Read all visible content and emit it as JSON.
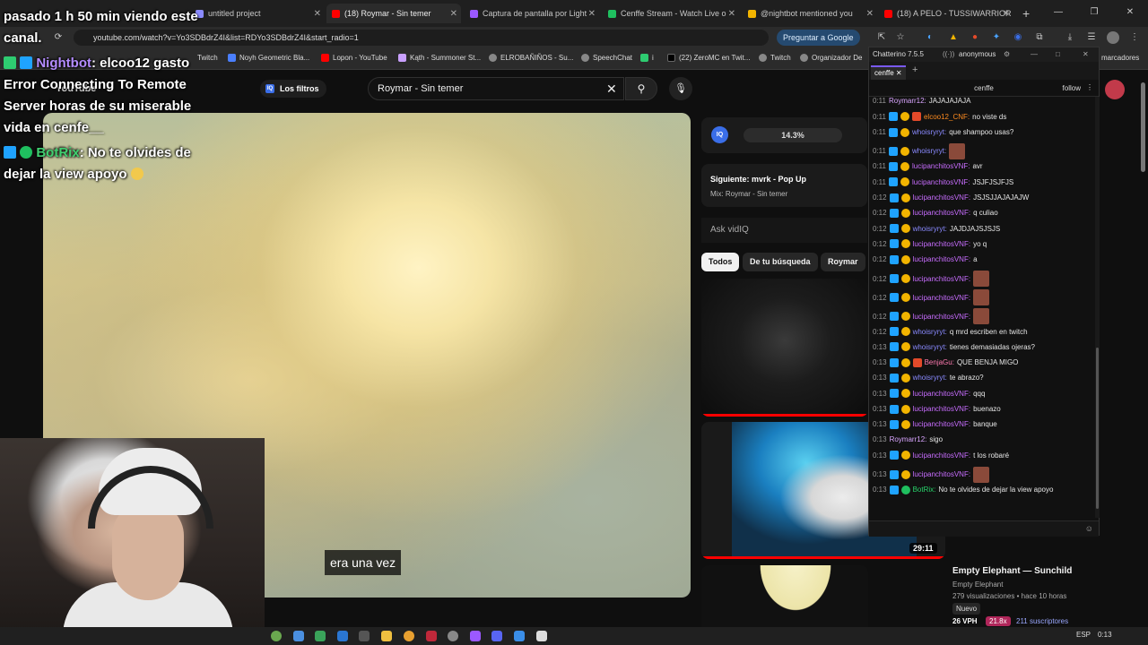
{
  "browser": {
    "tabs": [
      {
        "label": "untitled project",
        "color": "#8a8aff"
      },
      {
        "label": "(18) Roymar - Sin temer",
        "color": "#ff0000"
      },
      {
        "label": "Captura de pantalla por Light",
        "color": "#9b59ff"
      },
      {
        "label": "Cenffe Stream - Watch Live o",
        "color": "#1fbf5f"
      },
      {
        "label": "@nightbot mentioned you",
        "color": "#f2b400"
      },
      {
        "label": "(18) A PELO - TUSSIWARRIOR",
        "color": "#ff0000"
      }
    ],
    "url": "youtube.com/watch?v=Yo3SDBdrZ4I&list=RDYo3SDBdrZ4I&start_radio=1",
    "translate_button": "Preguntar a Google",
    "bookmarks": [
      "Twitch",
      "Noyh Geometric Bla...",
      "Lopon - YouTube",
      "Kąth - Summoner St...",
      "ELROBAÑIÑOS - Su...",
      "SpeechChat",
      "i",
      "(22) ZeroMC en Twit...",
      "Twitch",
      "Organizador De",
      "marcadores"
    ]
  },
  "overlay": {
    "line1": "pasado 1 h 50 min viendo este",
    "line2": "canal.",
    "nightbot_name": "Nightbot",
    "nightbot_msg": ": elcoo12 gasto",
    "error_line1": "Error Connecting To Remote",
    "error_line2": "Server horas de su miserable",
    "error_line3": "vida en cenfe__",
    "botrix_name": "BotRix",
    "botrix_msg_line1": ": No te olvides de",
    "botrix_msg_line2": "dejar la view apoyo"
  },
  "youtube": {
    "logo_text": "YouTube",
    "filters": "Los filtros",
    "search_value": "Roymar - Sin temer",
    "subtitle": "era una vez",
    "vidiq_label": "IQ",
    "vidiq_percent": "14.3%",
    "next_label": "Siguiente: mvrk - Pop Up",
    "next_sub": "Mix: Roymar - Sin temer",
    "ask_placeholder": "Ask vidIQ",
    "chips": [
      "Todos",
      "De tu búsqueda",
      "Roymar"
    ],
    "duration2": "29:11",
    "rec_title": "Empty Elephant — Sunchild",
    "rec_channel": "Empty Elephant",
    "rec_meta": "279 visualizaciones • hace 10 horas",
    "rec_badge": "Nuevo",
    "rec_vph": "26 VPH",
    "rec_score": "21.8x",
    "rec_subs": "211 suscriptores"
  },
  "chatterino": {
    "title": "Chatterino 7.5.5",
    "user": "anonymous",
    "tab": "cenffe",
    "channel": "cenffe",
    "follow": "follow",
    "messages": [
      {
        "ts": "0:11",
        "user": "Roymarr12:",
        "cls": "u-roy",
        "text": "JAJAJAJAJA",
        "icons": ""
      },
      {
        "ts": "0:11",
        "user": "elcoo12_CNF:",
        "cls": "u-elco",
        "text": "no viste ds",
        "icons": "bgr"
      },
      {
        "ts": "0:11",
        "user": "whoisryryt:",
        "cls": "u-whoi",
        "text": "que shampoo usas?",
        "icons": "bg"
      },
      {
        "ts": "0:11",
        "user": "whoisryryt:",
        "cls": "u-whoi",
        "text": "",
        "icons": "bg",
        "emote": true
      },
      {
        "ts": "0:11",
        "user": "lucipanchitosVNF:",
        "cls": "u-luci",
        "text": "avr",
        "icons": "bg"
      },
      {
        "ts": "0:11",
        "user": "lucipanchitosVNF:",
        "cls": "u-luci",
        "text": "JSJFJSJFJS",
        "icons": "bg"
      },
      {
        "ts": "0:12",
        "user": "lucipanchitosVNF:",
        "cls": "u-luci",
        "text": "JSJSJJAJAJAJW",
        "icons": "bg"
      },
      {
        "ts": "0:12",
        "user": "lucipanchitosVNF:",
        "cls": "u-luci",
        "text": "q culiao",
        "icons": "bg"
      },
      {
        "ts": "0:12",
        "user": "whoisryryt:",
        "cls": "u-whoi",
        "text": "JAJDJAJSJSJS",
        "icons": "bg"
      },
      {
        "ts": "0:12",
        "user": "lucipanchitosVNF:",
        "cls": "u-luci",
        "text": "yo q",
        "icons": "bg"
      },
      {
        "ts": "0:12",
        "user": "lucipanchitosVNF:",
        "cls": "u-luci",
        "text": "a",
        "icons": "bg"
      },
      {
        "ts": "0:12",
        "user": "lucipanchitosVNF:",
        "cls": "u-luci",
        "text": "",
        "icons": "bg",
        "emote": true
      },
      {
        "ts": "0:12",
        "user": "lucipanchitosVNF:",
        "cls": "u-luci",
        "text": "",
        "icons": "bg",
        "emote": true
      },
      {
        "ts": "0:12",
        "user": "lucipanchitosVNF:",
        "cls": "u-luci",
        "text": "",
        "icons": "bg",
        "emote": true
      },
      {
        "ts": "0:12",
        "user": "whoisryryt:",
        "cls": "u-whoi",
        "text": "q mrd escriben en twitch",
        "icons": "bg"
      },
      {
        "ts": "0:13",
        "user": "whoisryryt:",
        "cls": "u-whoi",
        "text": "tienes demasiadas ojeras?",
        "icons": "bg"
      },
      {
        "ts": "0:13",
        "user": "BenjaGu:",
        "cls": "u-benja",
        "text": "QUE BENJA MIGO",
        "icons": "bgr"
      },
      {
        "ts": "0:13",
        "user": "whoisryryt:",
        "cls": "u-whoi",
        "text": "te abrazo?",
        "icons": "bg"
      },
      {
        "ts": "0:13",
        "user": "lucipanchitosVNF:",
        "cls": "u-luci",
        "text": "qqq",
        "icons": "bg"
      },
      {
        "ts": "0:13",
        "user": "lucipanchitosVNF:",
        "cls": "u-luci",
        "text": "buenazo",
        "icons": "bg"
      },
      {
        "ts": "0:13",
        "user": "lucipanchitosVNF:",
        "cls": "u-luci",
        "text": "banque",
        "icons": "bg"
      },
      {
        "ts": "0:13",
        "user": "Roymarr12:",
        "cls": "u-roy",
        "text": "sigo",
        "icons": ""
      },
      {
        "ts": "0:13",
        "user": "lucipanchitosVNF:",
        "cls": "u-luci",
        "text": "t los robaré",
        "icons": "bg"
      },
      {
        "ts": "0:13",
        "user": "lucipanchitosVNF:",
        "cls": "u-luci",
        "text": "",
        "icons": "bg",
        "emote": true
      },
      {
        "ts": "0:13",
        "user": "BotRix:",
        "cls": "u-bot",
        "text": "No te olvides de dejar la view apoyo",
        "icons": "bv"
      }
    ]
  },
  "taskbar": {
    "lang": "ESP",
    "time": "0:13"
  }
}
